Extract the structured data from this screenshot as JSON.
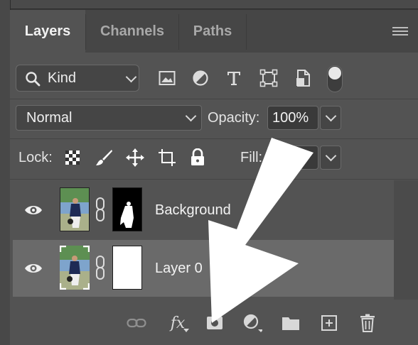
{
  "tabs": [
    {
      "label": "Layers",
      "active": true
    },
    {
      "label": "Channels",
      "active": false
    },
    {
      "label": "Paths",
      "active": false
    }
  ],
  "filter": {
    "kind_label": "Kind",
    "icons": [
      "image-filter-icon",
      "adjustment-filter-icon",
      "type-filter-icon",
      "shape-filter-icon",
      "smart-object-filter-icon"
    ],
    "filter_toggle_on": true
  },
  "blend": {
    "mode": "Normal",
    "opacity_label": "Opacity:",
    "opacity_value": "100%"
  },
  "lock": {
    "label": "Lock:",
    "fill_label": "Fill:"
  },
  "layers": [
    {
      "name": "Background",
      "visible": true,
      "selected": false,
      "mask": "silhouette"
    },
    {
      "name": "Layer 0",
      "visible": true,
      "selected": true,
      "mask": "white"
    }
  ],
  "footer_icons": [
    "link-layers-icon",
    "fx-icon",
    "add-mask-icon",
    "adjustment-layer-icon",
    "new-group-icon",
    "new-layer-icon",
    "delete-layer-icon"
  ],
  "fx_label": "fx",
  "colors": {
    "panel": "#535353",
    "selected_row": "#6a6a6a",
    "arrow": "#ffffff"
  }
}
